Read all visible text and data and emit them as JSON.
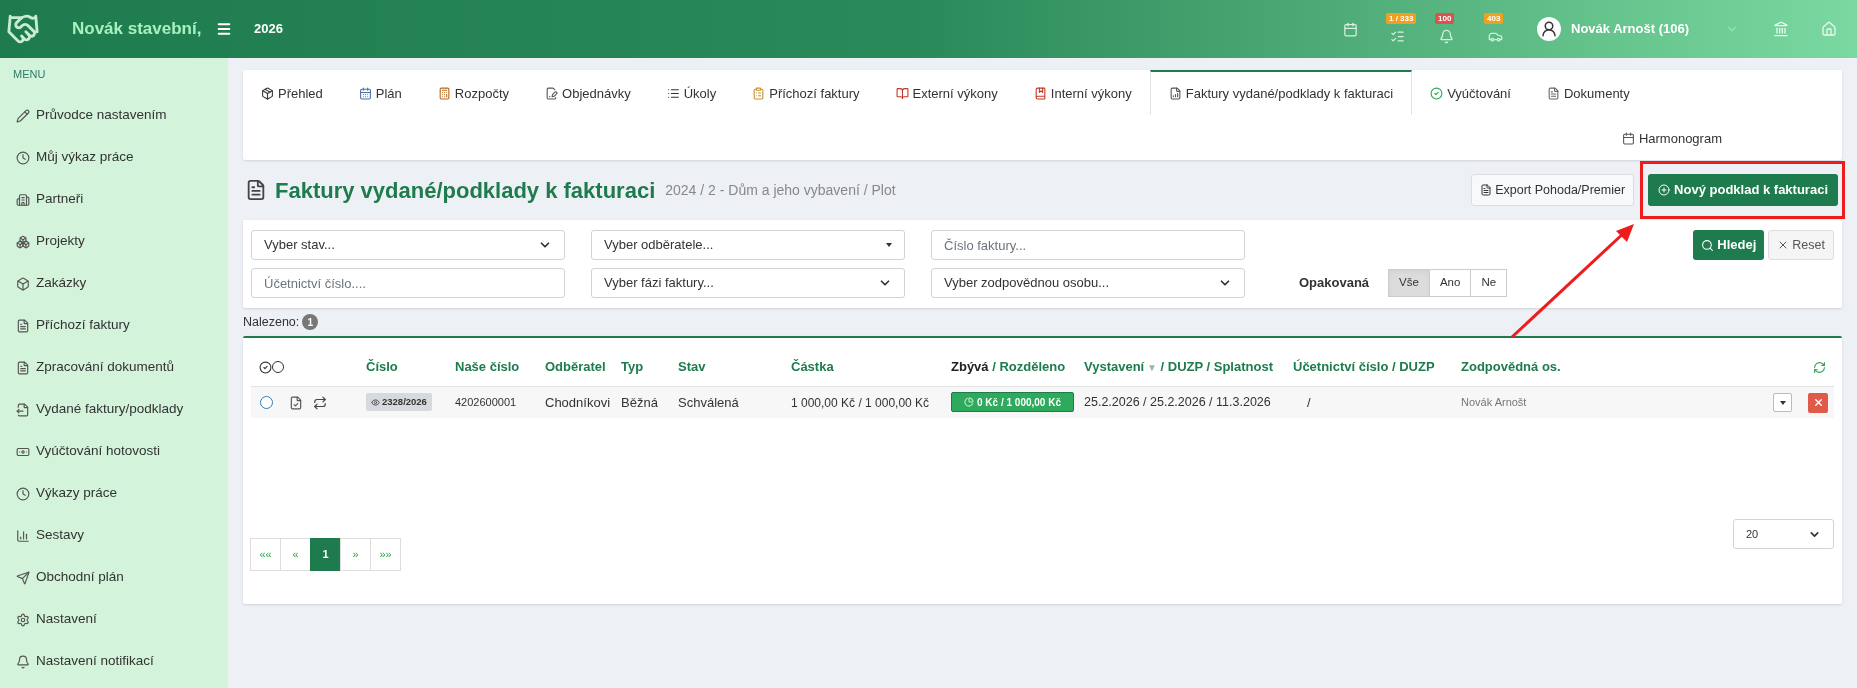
{
  "header": {
    "company": "Novák stavební,",
    "year": "2026",
    "badges": [
      {
        "kind": "tasks",
        "text": "1 / 333",
        "color": "#f0a020"
      },
      {
        "kind": "alerts",
        "text": "100",
        "color": "#d9534f"
      },
      {
        "kind": "car",
        "text": "403",
        "color": "#f0a020"
      }
    ],
    "user": "Novák Arnošt (106)"
  },
  "sidebar": {
    "title": "MENU",
    "items": [
      {
        "label": "Průvodce nastavením"
      },
      {
        "label": "Můj výkaz práce"
      },
      {
        "label": "Partneři"
      },
      {
        "label": "Projekty"
      },
      {
        "label": "Zakázky"
      },
      {
        "label": "Příchozí faktury"
      },
      {
        "label": "Zpracování dokumentů"
      },
      {
        "label": "Vydané faktury/podklady"
      },
      {
        "label": "Vyúčtování hotovosti"
      },
      {
        "label": "Výkazy práce"
      },
      {
        "label": "Sestavy"
      },
      {
        "label": "Obchodní plán"
      },
      {
        "label": "Nastavení"
      },
      {
        "label": "Nastavení notifikací"
      }
    ]
  },
  "tabs": [
    {
      "label": "Přehled",
      "selected": false
    },
    {
      "label": "Plán",
      "selected": false
    },
    {
      "label": "Rozpočty",
      "selected": false
    },
    {
      "label": "Objednávky",
      "selected": false
    },
    {
      "label": "Úkoly",
      "selected": false
    },
    {
      "label": "Příchozí faktury",
      "selected": false
    },
    {
      "label": "Externí výkony",
      "selected": false
    },
    {
      "label": "Interní výkony",
      "selected": false
    },
    {
      "label": "Faktury vydané/podklady k fakturaci",
      "selected": true
    },
    {
      "label": "Vyúčtování",
      "selected": false
    },
    {
      "label": "Dokumenty",
      "selected": false
    },
    {
      "label": "Harmonogram",
      "selected": false
    }
  ],
  "page": {
    "title": "Faktury vydané/podklady k fakturaci",
    "subtitle": "2024 / 2 - Dům a jeho vybavení / Plot",
    "export_button": "Export Pohoda/Premier",
    "new_button": {
      "label": "Nový podklad k fakturaci",
      "highlighted": true
    }
  },
  "filters": {
    "row1": [
      {
        "kind": "select",
        "text": "Vyber stav..."
      },
      {
        "kind": "combo",
        "text": "Vyber odběratele..."
      },
      {
        "kind": "input",
        "placeholder": "Číslo faktury..."
      }
    ],
    "row2": [
      {
        "kind": "input",
        "placeholder": "Účetnictví číslo...."
      },
      {
        "kind": "select",
        "text": "Vyber fázi faktury..."
      },
      {
        "kind": "select",
        "text": "Vyber zodpovědnou osobu..."
      }
    ],
    "search_button": "Hledej",
    "reset_button": "Reset",
    "recurring_label": "Opakovaná",
    "recurring_options": [
      {
        "label": "Vše",
        "selected": true
      },
      {
        "label": "Ano",
        "selected": false
      },
      {
        "label": "Ne",
        "selected": false
      }
    ]
  },
  "found": {
    "label": "Nalezeno:",
    "count": "1"
  },
  "table": {
    "columns": [
      {
        "label": "Číslo"
      },
      {
        "label": "Naše číslo"
      },
      {
        "label": "Odběratel"
      },
      {
        "label": "Typ"
      },
      {
        "label": "Stav"
      },
      {
        "label": "Částka"
      },
      {
        "label": "Zbývá",
        "emphasized": true,
        "rest": "/ Rozděleno"
      },
      {
        "label": "Vystavení",
        "sort_mark": "▼",
        "rest": "/ DUZP / Splatnost"
      },
      {
        "label": "Účetnictví číslo / DUZP"
      },
      {
        "label": "Zodpovědná os."
      }
    ],
    "rows": [
      {
        "selected": false,
        "number": "2328/2026",
        "our_number": "4202600001",
        "customer": "Chodníkovi",
        "type": "Běžná",
        "status": "Schválená",
        "amount": "1 000,00 Kč / 1 000,00 Kč",
        "remaining": "0 Kč / 1 000,00 Kč",
        "dates": "25.2.2026 / 25.2.2026 / 11.3.2026",
        "accounting": "/",
        "responsible": "Novák Arnošt"
      }
    ]
  },
  "pagination": {
    "pages": [
      {
        "label": "««",
        "selected": false
      },
      {
        "label": "«",
        "selected": false
      },
      {
        "label": "1",
        "selected": true
      },
      {
        "label": "»",
        "selected": false
      },
      {
        "label": "»»",
        "selected": false
      }
    ],
    "page_size": "20"
  }
}
